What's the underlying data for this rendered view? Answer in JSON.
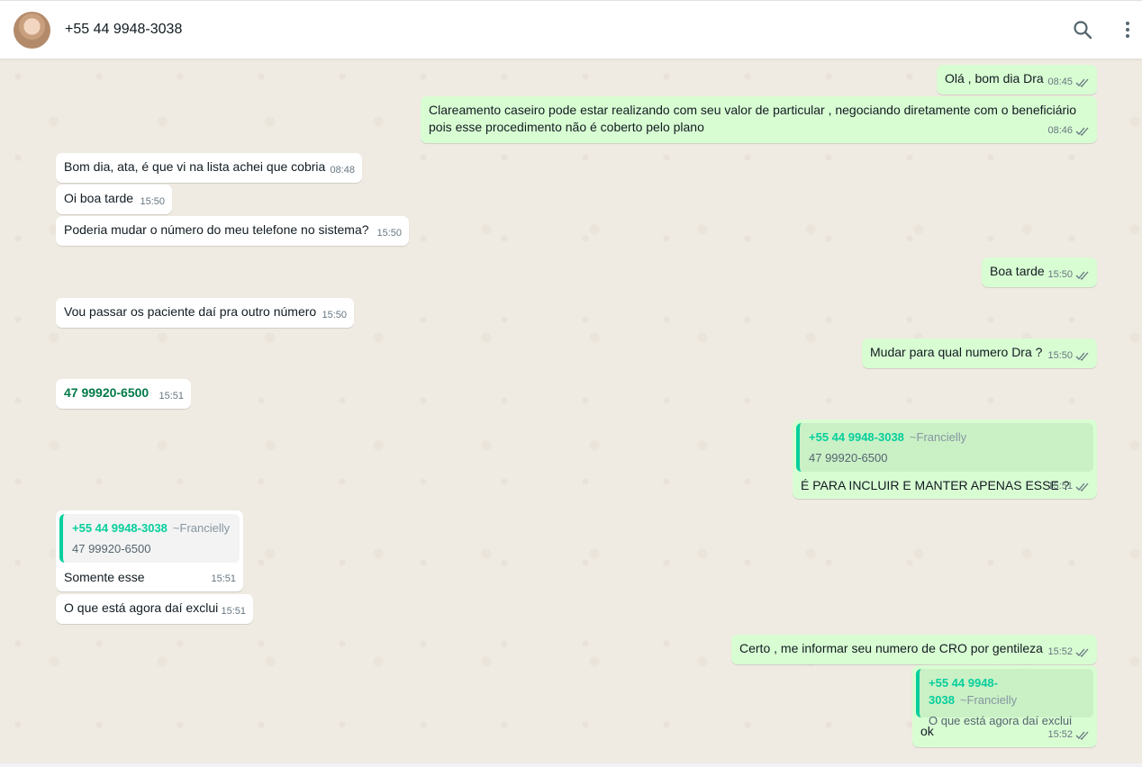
{
  "header": {
    "contact_name": "+55 44 9948-3038",
    "icons": [
      "search-icon",
      "menu-icon"
    ]
  },
  "messages": [
    {
      "dir": "out",
      "text": "Olá , bom dia Dra",
      "time": "08:45"
    },
    {
      "dir": "out",
      "text": "Clareamento caseiro pode estar realizando com seu valor de particular , negociando diretamente com o beneficiário pois esse procedimento não é coberto pelo plano",
      "time": "08:46"
    },
    {
      "dir": "in",
      "text": "Bom dia, ata, é que vi na lista achei que cobria",
      "time": "08:48"
    },
    {
      "dir": "in",
      "text": "Oi boa tarde",
      "time": "15:50"
    },
    {
      "dir": "in",
      "text": "Poderia mudar o número do meu telefone no sistema?",
      "time": "15:50"
    },
    {
      "dir": "out",
      "text": "Boa tarde",
      "time": "15:50"
    },
    {
      "dir": "in",
      "text": "Vou passar os paciente daí pra outro número",
      "time": "15:50"
    },
    {
      "dir": "out",
      "text": "Mudar para qual numero Dra ?",
      "time": "15:50"
    },
    {
      "dir": "in",
      "text": "47 99920-6500",
      "time": "15:51"
    },
    {
      "dir": "out",
      "quote": {
        "author": "+55 44 9948-3038",
        "alias": "~Francielly",
        "text": "47 99920-6500"
      },
      "text": "É PARA INCLUIR E MANTER APENAS ESSE ?",
      "time": "15:51"
    },
    {
      "dir": "in",
      "quote": {
        "author": "+55 44 9948-3038",
        "alias": "~Francielly",
        "text": "47 99920-6500"
      },
      "text": "Somente esse",
      "time": "15:51"
    },
    {
      "dir": "in",
      "text": "O que está agora daí exclui",
      "time": "15:51"
    },
    {
      "dir": "out",
      "text": "Certo , me informar seu numero de CRO por gentileza",
      "time": "15:52"
    },
    {
      "dir": "out",
      "quote": {
        "author": "+55 44 9948-3038",
        "alias": "~Francielly",
        "text": "O que está agora daí exclui"
      },
      "text": "ok",
      "time": "15:52"
    }
  ]
}
